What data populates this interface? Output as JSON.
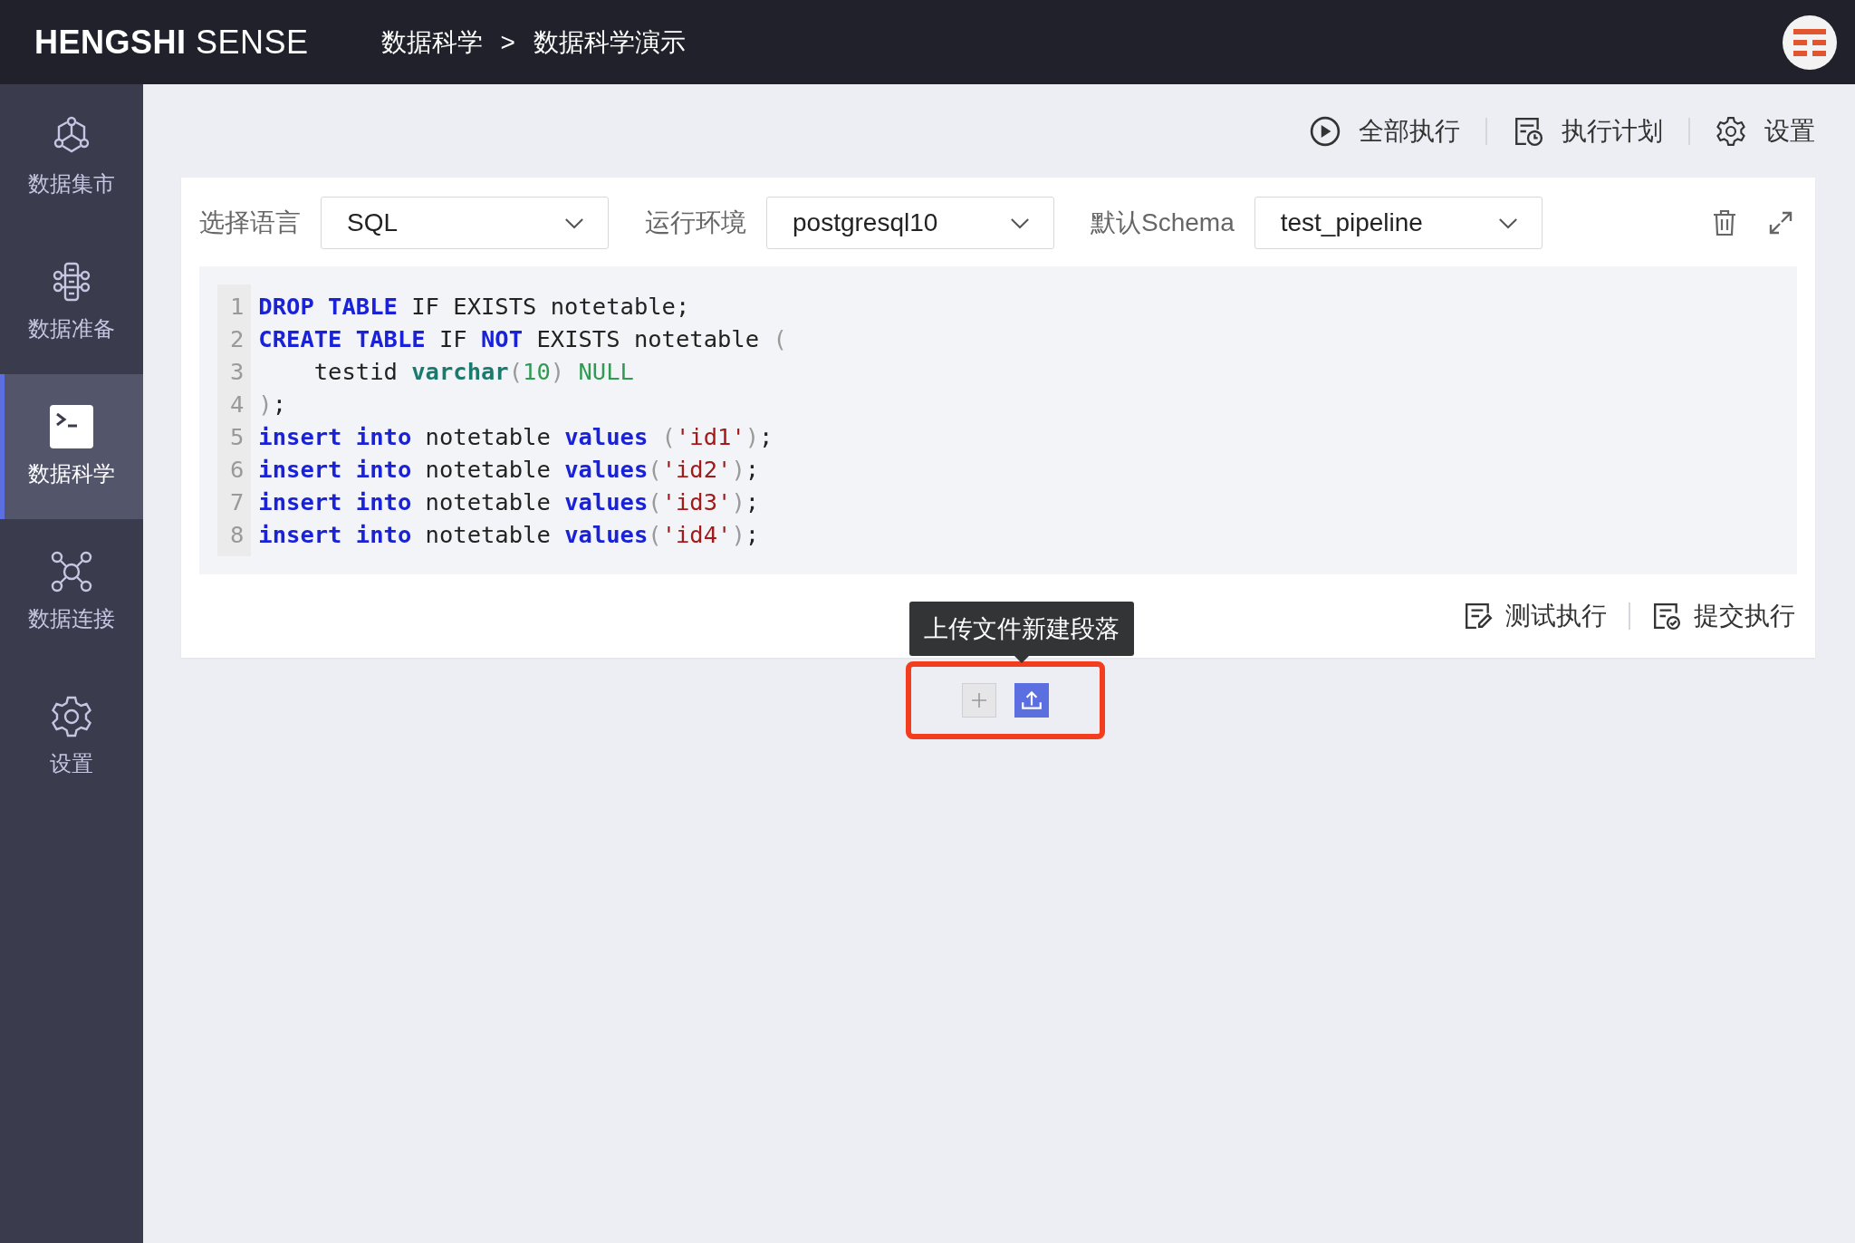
{
  "header": {
    "logo_bold": "HENGSHI",
    "logo_light": "SENSE",
    "breadcrumb": [
      "数据科学",
      "数据科学演示"
    ],
    "breadcrumb_separator": ">"
  },
  "sidebar": {
    "items": [
      {
        "label": "数据集市",
        "selected": false
      },
      {
        "label": "数据准备",
        "selected": false
      },
      {
        "label": "数据科学",
        "selected": true
      },
      {
        "label": "数据连接",
        "selected": false
      },
      {
        "label": "设置",
        "selected": false
      }
    ]
  },
  "toolbar": {
    "actions": [
      {
        "label": "全部执行",
        "kind": "run"
      },
      {
        "label": "执行计划",
        "kind": "schedule"
      },
      {
        "label": "设置",
        "kind": "settings"
      }
    ]
  },
  "paragraph": {
    "fields": [
      {
        "label": "选择语言",
        "value": "SQL"
      },
      {
        "label": "运行环境",
        "value": "postgresql10"
      },
      {
        "label": "默认Schema",
        "value": "test_pipeline"
      }
    ],
    "code": [
      {
        "number": "1",
        "tokens": [
          {
            "kind": "keyword",
            "text": "DROP TABLE"
          },
          {
            "kind": "plain",
            "text": " IF EXISTS notetable;"
          }
        ]
      },
      {
        "number": "2",
        "tokens": [
          {
            "kind": "keyword",
            "text": "CREATE TABLE"
          },
          {
            "kind": "plain",
            "text": " IF "
          },
          {
            "kind": "keyword",
            "text": "NOT"
          },
          {
            "kind": "plain",
            "text": " EXISTS notetable "
          },
          {
            "kind": "paren",
            "text": "("
          }
        ]
      },
      {
        "number": "3",
        "tokens": [
          {
            "kind": "plain",
            "text": "    testid "
          },
          {
            "kind": "type",
            "text": "varchar"
          },
          {
            "kind": "paren",
            "text": "("
          },
          {
            "kind": "number",
            "text": "10"
          },
          {
            "kind": "paren",
            "text": ")"
          },
          {
            "kind": "null",
            "text": " NULL"
          }
        ]
      },
      {
        "number": "4",
        "tokens": [
          {
            "kind": "paren",
            "text": ")"
          },
          {
            "kind": "plain",
            "text": ";"
          }
        ]
      },
      {
        "number": "5",
        "tokens": [
          {
            "kind": "keyword",
            "text": "insert into"
          },
          {
            "kind": "plain",
            "text": " notetable "
          },
          {
            "kind": "keyword",
            "text": "values"
          },
          {
            "kind": "paren",
            "text": " ("
          },
          {
            "kind": "string",
            "text": "'id1'"
          },
          {
            "kind": "paren",
            "text": ")"
          },
          {
            "kind": "plain",
            "text": ";"
          }
        ]
      },
      {
        "number": "6",
        "tokens": [
          {
            "kind": "keyword",
            "text": "insert into"
          },
          {
            "kind": "plain",
            "text": " notetable "
          },
          {
            "kind": "keyword",
            "text": "values"
          },
          {
            "kind": "paren",
            "text": "("
          },
          {
            "kind": "string",
            "text": "'id2'"
          },
          {
            "kind": "paren",
            "text": ")"
          },
          {
            "kind": "plain",
            "text": ";"
          }
        ]
      },
      {
        "number": "7",
        "tokens": [
          {
            "kind": "keyword",
            "text": "insert into"
          },
          {
            "kind": "plain",
            "text": " notetable "
          },
          {
            "kind": "keyword",
            "text": "values"
          },
          {
            "kind": "paren",
            "text": "("
          },
          {
            "kind": "string",
            "text": "'id3'"
          },
          {
            "kind": "paren",
            "text": ")"
          },
          {
            "kind": "plain",
            "text": ";"
          }
        ]
      },
      {
        "number": "8",
        "tokens": [
          {
            "kind": "keyword",
            "text": "insert into"
          },
          {
            "kind": "plain",
            "text": " notetable "
          },
          {
            "kind": "keyword",
            "text": "values"
          },
          {
            "kind": "paren",
            "text": "("
          },
          {
            "kind": "string",
            "text": "'id4'"
          },
          {
            "kind": "paren",
            "text": ")"
          },
          {
            "kind": "plain",
            "text": ";"
          }
        ]
      }
    ],
    "footer_actions": [
      {
        "label": "测试执行",
        "kind": "test"
      },
      {
        "label": "提交执行",
        "kind": "submit"
      }
    ]
  },
  "add_paragraph": {
    "tooltip": "上传文件新建段落"
  }
}
